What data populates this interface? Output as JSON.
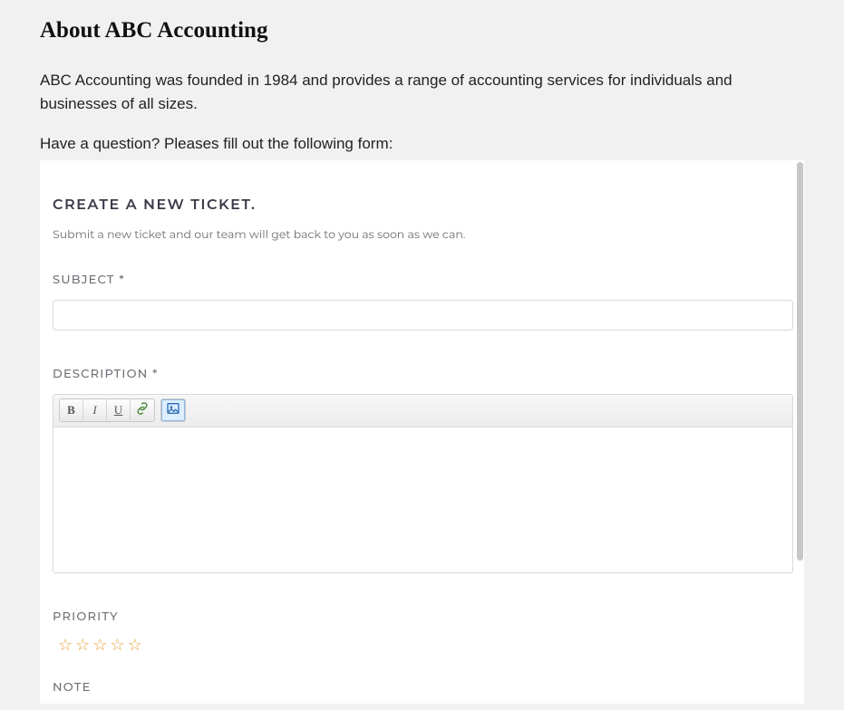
{
  "header": {
    "title": "About ABC Accounting",
    "intro": "ABC Accounting was founded in 1984 and provides a range of accounting services for individuals and businesses of all sizes.",
    "prompt": "Have a question? Pleases fill out the following form:"
  },
  "form": {
    "heading": "CREATE A NEW TICKET.",
    "subtext": "Submit a new ticket and our team will get back to you as soon as we can.",
    "fields": {
      "subject": {
        "label": "SUBJECT *",
        "value": ""
      },
      "description": {
        "label": "DESCRIPTION *",
        "value": ""
      },
      "priority": {
        "label": "PRIORITY",
        "value": 0,
        "max": 5
      },
      "note": {
        "label": "NOTE",
        "value": ""
      }
    },
    "toolbar": {
      "bold": "B",
      "italic": "I",
      "underline": "U"
    }
  }
}
